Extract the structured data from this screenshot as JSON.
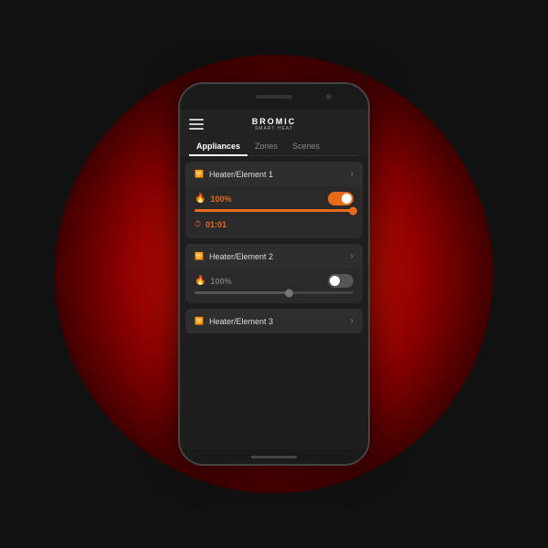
{
  "background": {
    "glow_color": "#cc1100"
  },
  "app": {
    "brand_name": "BROMIC",
    "brand_sub": "SMART·HEAT",
    "hamburger_label": "menu"
  },
  "tabs": [
    {
      "id": "appliances",
      "label": "Appliances",
      "active": true
    },
    {
      "id": "zones",
      "label": "Zones",
      "active": false
    },
    {
      "id": "scenes",
      "label": "Scenes",
      "active": false
    }
  ],
  "devices": [
    {
      "id": "device-1",
      "name": "Heater/Element 1",
      "power_on": true,
      "power_pct": "100%",
      "slider_pct": 100,
      "has_timer": true,
      "timer_value": "01:01"
    },
    {
      "id": "device-2",
      "name": "Heater/Element 2",
      "power_on": false,
      "power_pct": "100%",
      "slider_pct": 60,
      "has_timer": false,
      "timer_value": null
    },
    {
      "id": "device-3",
      "name": "Heater/Element 3",
      "power_on": false,
      "power_pct": null,
      "slider_pct": null,
      "has_timer": false,
      "timer_value": null
    }
  ],
  "icons": {
    "wifi": "≋",
    "flame": "🔥",
    "timer": "⏱",
    "chevron": "›"
  }
}
